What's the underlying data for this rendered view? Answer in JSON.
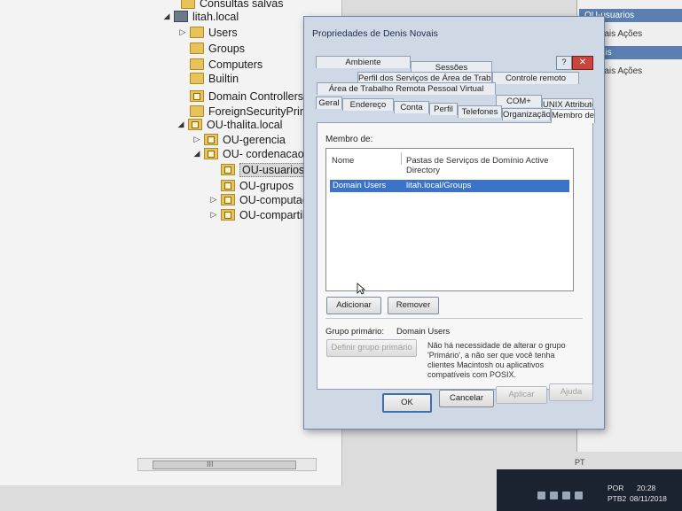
{
  "tree": {
    "items": [
      {
        "label": "Consultas salvas",
        "icon": "folder-icon",
        "toggle": ""
      },
      {
        "label": "litah.local",
        "icon": "domain-icon",
        "toggle": "◢"
      },
      {
        "label": "Users",
        "icon": "folder-icon",
        "toggle": "▷"
      },
      {
        "label": "Groups",
        "icon": "folder-icon",
        "toggle": ""
      },
      {
        "label": "Computers",
        "icon": "folder-icon",
        "toggle": ""
      },
      {
        "label": "Builtin",
        "icon": "folder-icon",
        "toggle": ""
      },
      {
        "label": "Domain Controllers",
        "icon": "ou-icon",
        "toggle": ""
      },
      {
        "label": "ForeignSecurityPrinci",
        "icon": "folder-icon",
        "toggle": ""
      },
      {
        "label": "OU-thalita.local",
        "icon": "ou-icon",
        "toggle": "◢"
      },
      {
        "label": "OU-gerencia",
        "icon": "ou-icon",
        "toggle": "▷"
      },
      {
        "label": "OU- cordenacao",
        "icon": "ou-icon",
        "toggle": "◢"
      },
      {
        "label": "OU-usuarios",
        "icon": "ou-icon",
        "toggle": "",
        "selected": true
      },
      {
        "label": "OU-grupos",
        "icon": "ou-icon",
        "toggle": ""
      },
      {
        "label": "OU-computac",
        "icon": "ou-icon",
        "toggle": "▷"
      },
      {
        "label": "OU-compartil",
        "icon": "ou-icon",
        "toggle": "▷"
      }
    ],
    "scroll_grip": "III"
  },
  "actions": {
    "header1": "OU-usuarios",
    "item1": "Mais Ações",
    "header2": "Novais",
    "item2": "Mais Ações"
  },
  "dialog": {
    "title": "Propriedades de Denis Novais",
    "help": "?",
    "close": "✕",
    "tabs": {
      "ambiente": "Ambiente",
      "sessoes": "Sessões",
      "controle": "Controle remoto",
      "perfil_rds": "Perfil dos Serviços de Área de Trabalho Remota",
      "area_trabalho": "Área de Trabalho Remota Pessoal Virtual",
      "com": "COM+",
      "unix": "UNIX Attributes",
      "geral": "Geral",
      "endereco": "Endereço",
      "conta": "Conta",
      "perfil": "Perfil",
      "telefones": "Telefones",
      "organizacao": "Organização",
      "membro": "Membro de"
    },
    "member_of_label": "Membro de:",
    "columns": [
      "Nome",
      "Pastas de Serviços de Domínio Active Directory"
    ],
    "rows": [
      {
        "name": "Domain Users",
        "folder": "litah.local/Groups"
      }
    ],
    "add_button": "Adicionar",
    "remove_button": "Remover",
    "primary_group_label": "Grupo primário:",
    "primary_group_value": "Domain Users",
    "set_primary_button": "Definir grupo primário",
    "note": "Não há necessidade de alterar o grupo 'Primário', a não ser que você tenha clientes Macintosh ou aplicativos compatíveis com POSIX.",
    "ok": "OK",
    "cancel": "Cancelar",
    "apply": "Aplicar",
    "help_button": "Ajuda"
  },
  "taskbar": {
    "lang": "POR",
    "layout": "PTB2",
    "time": "20:28",
    "date": "08/11/2018",
    "lang_bar": "PT"
  },
  "colors": {
    "selection": "#3a73c9",
    "dialog_bg": "#cfd9e6",
    "close": "#c9463d"
  }
}
